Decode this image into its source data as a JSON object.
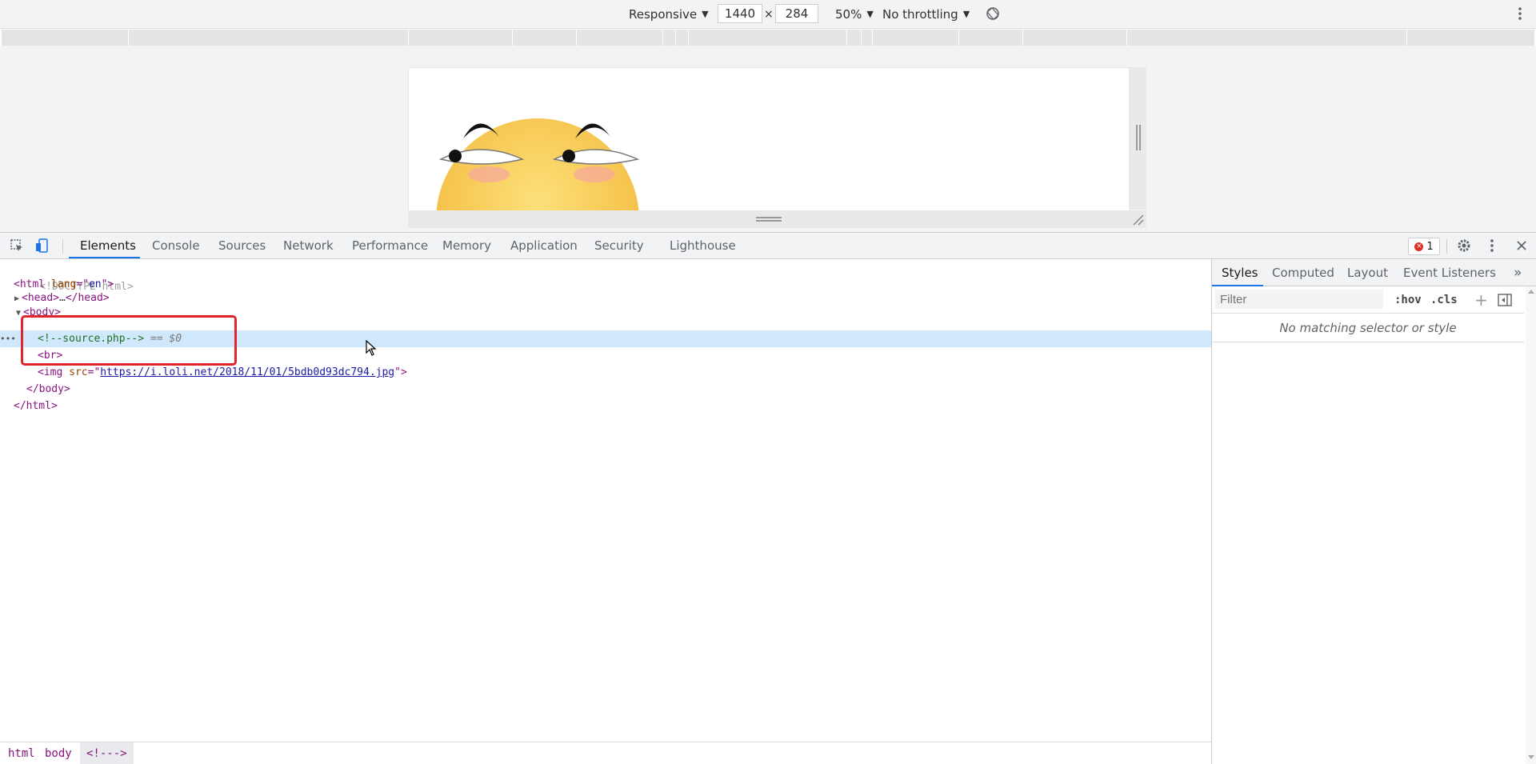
{
  "device_toolbar": {
    "device": "Responsive",
    "width": "1440",
    "x_sep": "×",
    "height": "284",
    "zoom": "50%",
    "throttling": "No throttling",
    "caret": "▼"
  },
  "devtools_tabs": [
    "Elements",
    "Console",
    "Sources",
    "Network",
    "Performance",
    "Memory",
    "Application",
    "Security",
    "Lighthouse"
  ],
  "error_count": "1",
  "dom": {
    "doctype": "<!DOCTYPE html>",
    "html_open_tag": "<html",
    "html_attr": " lang",
    "html_eq": "=\"",
    "html_val": "en",
    "html_close_quote": "\">",
    "head_open": "<head>",
    "head_ellipsis": "…",
    "head_close": "</head>",
    "body_open": "<body>",
    "comment": "<!--source.php-->",
    "comment_suffix": " == $0",
    "br": "<br>",
    "img_open": "<img",
    "img_attr": " src",
    "img_eq": "=\"",
    "img_src": "https://i.loli.net/2018/11/01/5bdb0d93dc794.jpg",
    "img_close": "\">",
    "body_close": "</body>",
    "html_close": "</html>",
    "row_dots": "•••"
  },
  "breadcrumb": [
    "html",
    "body",
    "<!--->"
  ],
  "styles_panel": {
    "tabs": [
      "Styles",
      "Computed",
      "Layout",
      "Event Listeners"
    ],
    "more": "»",
    "filter_placeholder": "Filter",
    "hov": ":hov",
    "cls": ".cls",
    "plus": "+",
    "empty_message": "No matching selector or style"
  },
  "colors": {
    "accent": "#1a73e8",
    "highlight_box": "#e0242b",
    "selected_row": "#cfe8fc"
  }
}
